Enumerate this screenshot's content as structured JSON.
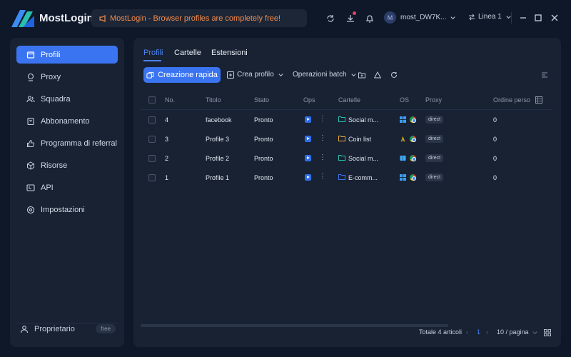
{
  "app": {
    "name": "MostLogin"
  },
  "notice": {
    "text": "MostLogin - Browser profiles are completely free!"
  },
  "user": {
    "initial": "M",
    "name": "most_DW7K..."
  },
  "line": {
    "label": "Linea 1"
  },
  "sidebar": {
    "items": [
      {
        "label": "Profili",
        "icon": "profiles-icon",
        "active": true
      },
      {
        "label": "Proxy",
        "icon": "proxy-icon"
      },
      {
        "label": "Squadra",
        "icon": "team-icon"
      },
      {
        "label": "Abbonamento",
        "icon": "subscription-icon"
      },
      {
        "label": "Programma di referral",
        "icon": "referral-icon"
      },
      {
        "label": "Risorse",
        "icon": "resources-icon"
      },
      {
        "label": "API",
        "icon": "api-icon"
      },
      {
        "label": "Impostazioni",
        "icon": "settings-icon"
      }
    ],
    "owner": {
      "label": "Proprietario",
      "plan": "free"
    }
  },
  "tabs": [
    {
      "label": "Profili",
      "active": true
    },
    {
      "label": "Cartelle"
    },
    {
      "label": "Estensioni"
    }
  ],
  "toolbar": {
    "quick_create": "Creazione rapida",
    "create_profile": "Crea profilo",
    "batch": "Operazioni batch"
  },
  "table": {
    "columns": [
      "No.",
      "Titolo",
      "Stato",
      "Ops",
      "Cartelle",
      "OS",
      "Proxy",
      "Ordine perso"
    ],
    "rows": [
      {
        "no": "4",
        "title": "facebook",
        "status": "Pronto",
        "folder": "Social m...",
        "folder_color": "#2bbfae",
        "os": "windows",
        "proxy": "direct",
        "order": "0"
      },
      {
        "no": "3",
        "title": "Profile 3",
        "status": "Pronto",
        "folder": "Coin list",
        "folder_color": "#f0a640",
        "os": "linux",
        "proxy": "direct",
        "order": "0"
      },
      {
        "no": "2",
        "title": "Profile 2",
        "status": "Pronto",
        "folder": "Social m...",
        "folder_color": "#2bbfae",
        "os": "mac",
        "proxy": "direct",
        "order": "0"
      },
      {
        "no": "1",
        "title": "Profile 1",
        "status": "Pronto",
        "folder": "E-comm...",
        "folder_color": "#3b74f0",
        "os": "windows",
        "proxy": "direct",
        "order": "0"
      }
    ]
  },
  "footer": {
    "total": "Totale 4 articoli",
    "page": "1",
    "per_page": "10 / pagina"
  },
  "colors": {
    "accent": "#3b74f0",
    "notice": "#f58a4a",
    "background": "#0f1828",
    "panel": "#182233"
  }
}
